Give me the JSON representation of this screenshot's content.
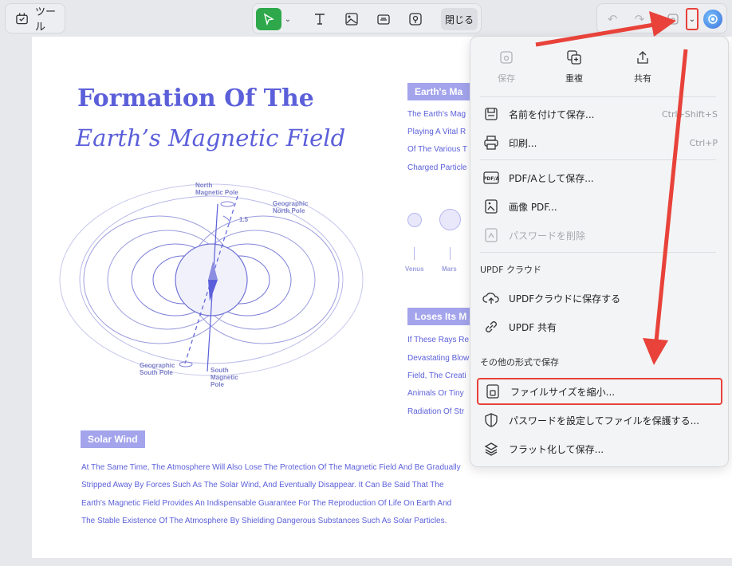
{
  "toolbar": {
    "tools_label": "ツール",
    "close_label": "閉じる"
  },
  "document": {
    "title_line1": "Formation Of The",
    "title_line2": "Earth’s Magnetic Field",
    "section1_tag": "Earth's Ma",
    "section1_lines": [
      "The Earth's Mag",
      "Playing A Vital R",
      "Of The Various T",
      "Charged Particle"
    ],
    "section2_tag": "Loses Its M",
    "section2_lines": [
      "If These Rays Re",
      "Devastating Blow",
      "Field, The Creati",
      "Animals Or Tiny",
      "Radiation Of Str"
    ],
    "solar_wind_tag": "Solar Wind",
    "solar_wind_lines": [
      "At The Same Time, The Atmosphere Will Also Lose The Protection Of The Magnetic Field And Be Gradually",
      "Stripped Away By Forces Such As The Solar Wind, And Eventually Disappear. It Can Be Said That The",
      "Earth's Magnetic Field Provides An Indispensable Guarantee For The Reproduction Of Life On Earth And",
      "The Stable Existence Of The Atmosphere By Shielding Dangerous Substances Such As Solar Particles."
    ],
    "diagram": {
      "north_magnetic": [
        "North",
        "Magnetic Pole"
      ],
      "geographic_north": [
        "Geographic",
        "North Pole"
      ],
      "angle": "1.5",
      "geographic_south": [
        "Geographic",
        "South Pole"
      ],
      "south_magnetic": [
        "South",
        "Magnetic",
        "Pole"
      ]
    },
    "planets": [
      "Venus",
      "Mars"
    ]
  },
  "menu": {
    "top_actions": [
      {
        "label": "保存",
        "icon": "save-icon",
        "disabled": true
      },
      {
        "label": "重複",
        "icon": "duplicate-icon",
        "disabled": false
      },
      {
        "label": "共有",
        "icon": "share-icon",
        "disabled": false
      }
    ],
    "save_as": {
      "label": "名前を付けて保存...",
      "shortcut": "Ctrl+Shift+S"
    },
    "print": {
      "label": "印刷...",
      "shortcut": "Ctrl+P"
    },
    "save_pdfa": {
      "label": "PDF/Aとして保存..."
    },
    "image_pdf": {
      "label": "画像 PDF..."
    },
    "remove_password": {
      "label": "パスワードを削除"
    },
    "cloud_header": "UPDF クラウド",
    "save_cloud": {
      "label": "UPDFクラウドに保存する"
    },
    "updf_share": {
      "label": "UPDF 共有"
    },
    "other_header": "その他の形式で保存",
    "reduce_size": {
      "label": "ファイルサイズを縮小..."
    },
    "protect_password": {
      "label": "パスワードを設定してファイルを保護する..."
    },
    "flatten": {
      "label": "フラット化して保存..."
    }
  },
  "colors": {
    "accent_green": "#2ea84b",
    "document_blue": "#5b5fd9",
    "annotation_red": "#e8423a"
  }
}
